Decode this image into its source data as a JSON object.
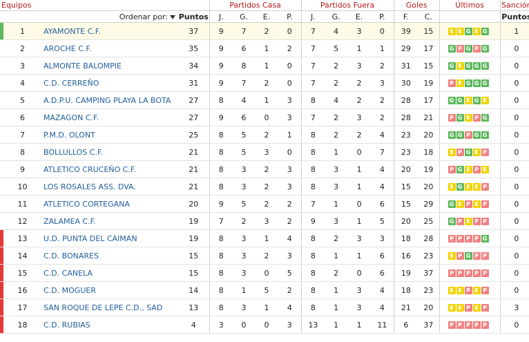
{
  "headers": {
    "equipos": "Equipos",
    "partidos_casa": "Partidos Casa",
    "partidos_fuera": "Partidos Fuera",
    "goles": "Goles",
    "ultimos": "Últimos",
    "sancion": "Sanción",
    "ordenar_por": "Ordenar por:",
    "puntos": "Puntos",
    "sub_casa": [
      "J.",
      "G.",
      "E.",
      "P."
    ],
    "sub_fuera": [
      "J.",
      "G.",
      "E.",
      "P."
    ],
    "goles_f": "F.",
    "goles_c": "C.",
    "sancion_puntos": "Puntos"
  },
  "colors": {
    "win": "#5cb85c",
    "draw": "#f0d400",
    "loss": "#f08080",
    "promotion": "#5cb85c",
    "relegation": "#e53935"
  },
  "rows": [
    {
      "pos": "1",
      "team": "AYAMONTE C.F.",
      "pts": "37",
      "cj": "9",
      "cg": "7",
      "ce": "2",
      "cp": "0",
      "fj": "7",
      "fg": "4",
      "fe": "3",
      "fp": "0",
      "gf": "39",
      "gc": "15",
      "forms": [
        "E",
        "E",
        "G",
        "E",
        "G"
      ],
      "sancion": "1",
      "marker": "promotion"
    },
    {
      "pos": "2",
      "team": "AROCHE C.F.",
      "pts": "35",
      "cj": "9",
      "cg": "6",
      "ce": "1",
      "cp": "2",
      "fj": "7",
      "fg": "5",
      "fe": "1",
      "fp": "1",
      "gf": "29",
      "gc": "17",
      "forms": [
        "G",
        "P",
        "G",
        "P",
        "G"
      ],
      "sancion": "0",
      "marker": ""
    },
    {
      "pos": "3",
      "team": "ALMONTE BALOMPIE",
      "pts": "34",
      "cj": "9",
      "cg": "8",
      "ce": "1",
      "cp": "0",
      "fj": "7",
      "fg": "2",
      "fe": "3",
      "fp": "2",
      "gf": "31",
      "gc": "15",
      "forms": [
        "G",
        "E",
        "G",
        "G",
        "G"
      ],
      "sancion": "0",
      "marker": ""
    },
    {
      "pos": "4",
      "team": "C.D. CERREÑO",
      "pts": "31",
      "cj": "9",
      "cg": "7",
      "ce": "2",
      "cp": "0",
      "fj": "7",
      "fg": "2",
      "fe": "2",
      "fp": "3",
      "gf": "30",
      "gc": "19",
      "forms": [
        "P",
        "E",
        "G",
        "G",
        "G"
      ],
      "sancion": "0",
      "marker": ""
    },
    {
      "pos": "5",
      "team": "A.D.P.U. CAMPING PLAYA LA BOTA",
      "pts": "27",
      "cj": "8",
      "cg": "4",
      "ce": "1",
      "cp": "3",
      "fj": "8",
      "fg": "4",
      "fe": "2",
      "fp": "2",
      "gf": "28",
      "gc": "17",
      "forms": [
        "G",
        "G",
        "E",
        "G",
        "E"
      ],
      "sancion": "0",
      "marker": ""
    },
    {
      "pos": "6",
      "team": "MAZAGON C.F.",
      "pts": "27",
      "cj": "9",
      "cg": "6",
      "ce": "0",
      "cp": "3",
      "fj": "7",
      "fg": "2",
      "fe": "3",
      "fp": "2",
      "gf": "28",
      "gc": "21",
      "forms": [
        "P",
        "G",
        "E",
        "P",
        "G"
      ],
      "sancion": "0",
      "marker": ""
    },
    {
      "pos": "7",
      "team": "P.M.D. OLONT",
      "pts": "25",
      "cj": "8",
      "cg": "5",
      "ce": "2",
      "cp": "1",
      "fj": "8",
      "fg": "2",
      "fe": "2",
      "fp": "4",
      "gf": "23",
      "gc": "20",
      "forms": [
        "G",
        "G",
        "P",
        "G",
        "G"
      ],
      "sancion": "0",
      "marker": ""
    },
    {
      "pos": "8",
      "team": "BOLLULLOS C.F.",
      "pts": "21",
      "cj": "8",
      "cg": "5",
      "ce": "3",
      "cp": "0",
      "fj": "8",
      "fg": "1",
      "fe": "0",
      "fp": "7",
      "gf": "23",
      "gc": "18",
      "forms": [
        "E",
        "P",
        "G",
        "E",
        "P"
      ],
      "sancion": "0",
      "marker": ""
    },
    {
      "pos": "9",
      "team": "ATLETICO CRUCEÑO C.F.",
      "pts": "21",
      "cj": "8",
      "cg": "3",
      "ce": "2",
      "cp": "3",
      "fj": "8",
      "fg": "3",
      "fe": "1",
      "fp": "4",
      "gf": "20",
      "gc": "19",
      "forms": [
        "P",
        "G",
        "E",
        "P",
        "E"
      ],
      "sancion": "0",
      "marker": ""
    },
    {
      "pos": "10",
      "team": "LOS ROSALES ASS. DVA.",
      "pts": "21",
      "cj": "8",
      "cg": "3",
      "ce": "2",
      "cp": "3",
      "fj": "8",
      "fg": "3",
      "fe": "1",
      "fp": "4",
      "gf": "15",
      "gc": "20",
      "forms": [
        "E",
        "G",
        "E",
        "E",
        "P"
      ],
      "sancion": "0",
      "marker": ""
    },
    {
      "pos": "11",
      "team": "ATLETICO CORTEGANA",
      "pts": "20",
      "cj": "9",
      "cg": "5",
      "ce": "2",
      "cp": "2",
      "fj": "7",
      "fg": "1",
      "fe": "0",
      "fp": "6",
      "gf": "15",
      "gc": "29",
      "forms": [
        "G",
        "E",
        "P",
        "E",
        "P"
      ],
      "sancion": "0",
      "marker": ""
    },
    {
      "pos": "12",
      "team": "ZALAMEA C.F.",
      "pts": "19",
      "cj": "7",
      "cg": "2",
      "ce": "3",
      "cp": "2",
      "fj": "9",
      "fg": "3",
      "fe": "1",
      "fp": "5",
      "gf": "20",
      "gc": "25",
      "forms": [
        "G",
        "P",
        "E",
        "P",
        "P"
      ],
      "sancion": "0",
      "marker": ""
    },
    {
      "pos": "13",
      "team": "U.D. PUNTA DEL CAIMAN",
      "pts": "19",
      "cj": "8",
      "cg": "3",
      "ce": "1",
      "cp": "4",
      "fj": "8",
      "fg": "2",
      "fe": "3",
      "fp": "3",
      "gf": "18",
      "gc": "28",
      "forms": [
        "P",
        "P",
        "P",
        "P",
        "G"
      ],
      "sancion": "0",
      "marker": "relegation"
    },
    {
      "pos": "14",
      "team": "C.D. BONARES",
      "pts": "15",
      "cj": "8",
      "cg": "3",
      "ce": "2",
      "cp": "3",
      "fj": "8",
      "fg": "1",
      "fe": "1",
      "fp": "6",
      "gf": "16",
      "gc": "23",
      "forms": [
        "E",
        "P",
        "G",
        "P",
        "P"
      ],
      "sancion": "0",
      "marker": "relegation"
    },
    {
      "pos": "15",
      "team": "C.D. CANELA",
      "pts": "15",
      "cj": "8",
      "cg": "3",
      "ce": "0",
      "cp": "5",
      "fj": "8",
      "fg": "2",
      "fe": "0",
      "fp": "6",
      "gf": "19",
      "gc": "37",
      "forms": [
        "P",
        "P",
        "P",
        "P",
        "P"
      ],
      "sancion": "0",
      "marker": "relegation"
    },
    {
      "pos": "16",
      "team": "C.D. MOGUER",
      "pts": "14",
      "cj": "8",
      "cg": "1",
      "ce": "5",
      "cp": "2",
      "fj": "8",
      "fg": "1",
      "fe": "3",
      "fp": "4",
      "gf": "18",
      "gc": "23",
      "forms": [
        "E",
        "E",
        "P",
        "E",
        "P"
      ],
      "sancion": "0",
      "marker": "relegation"
    },
    {
      "pos": "17",
      "team": "SAN ROQUE DE LEPE C.D., SAD",
      "pts": "13",
      "cj": "8",
      "cg": "3",
      "ce": "1",
      "cp": "4",
      "fj": "8",
      "fg": "1",
      "fe": "3",
      "fp": "4",
      "gf": "21",
      "gc": "20",
      "forms": [
        "E",
        "E",
        "P",
        "E",
        "P"
      ],
      "sancion": "3",
      "marker": "relegation"
    },
    {
      "pos": "18",
      "team": "C.D. RUBIAS",
      "pts": "4",
      "cj": "3",
      "cg": "0",
      "ce": "0",
      "cp": "3",
      "fj": "13",
      "fg": "1",
      "fe": "1",
      "fp": "11",
      "gf": "6",
      "gc": "37",
      "forms": [
        "P",
        "P",
        "P",
        "P",
        "P"
      ],
      "sancion": "0",
      "marker": "relegation"
    }
  ]
}
